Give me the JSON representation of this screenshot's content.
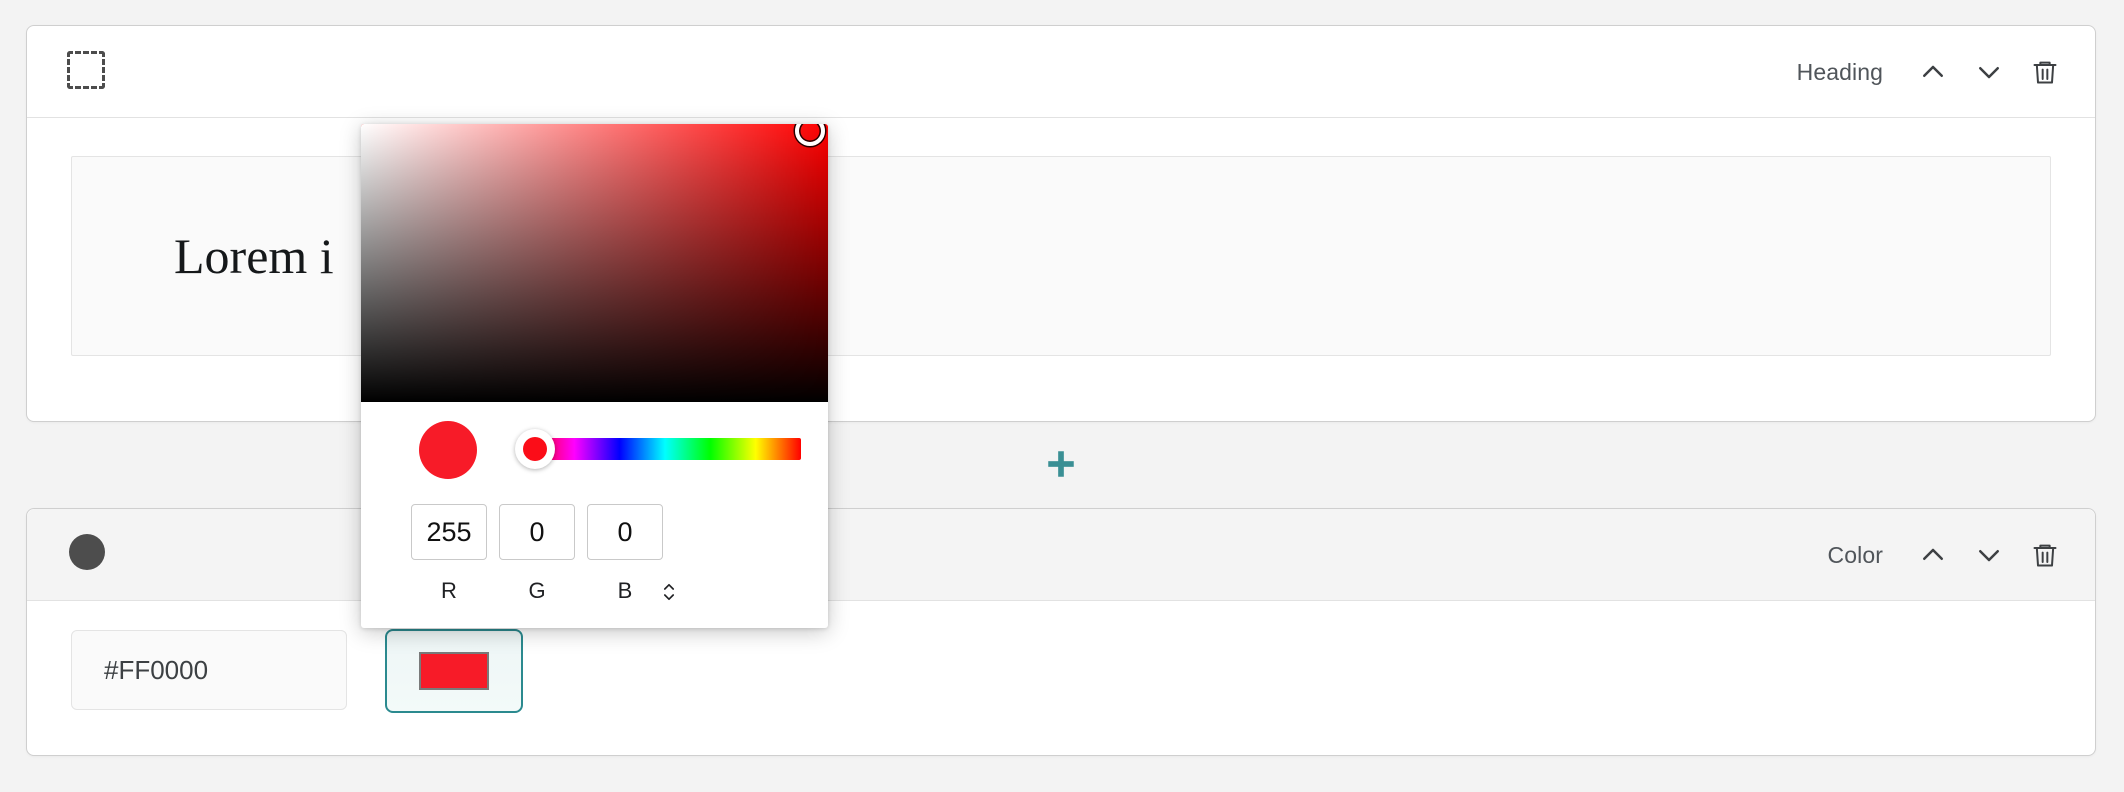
{
  "theme": {
    "page_background": "#f3f3f3",
    "accent_teal": "#2b8a8f",
    "selected_color_hex": "#FF0000",
    "selected_color_rgb_css": "#f71b28",
    "icon_gray": "#4d4d4d",
    "label_gray": "#50555a"
  },
  "blocks": [
    {
      "id": "heading",
      "icon": "dashed-square-icon",
      "type_label": "Heading",
      "move_up_label": "Move block up",
      "move_down_label": "Move block down",
      "delete_label": "Delete block",
      "field_value": "Lorem i"
    },
    {
      "id": "color",
      "icon": "filled-circle-icon",
      "type_label": "Color",
      "move_up_label": "Move block up",
      "move_down_label": "Move block down",
      "delete_label": "Delete block",
      "hex_value": "#FF0000",
      "hex_placeholder": "#FF0000",
      "swatch_label": "Open color picker"
    }
  ],
  "add_block": {
    "icon": "plus-icon",
    "label": "Add block"
  },
  "color_picker": {
    "visible": true,
    "sv_area_label": "Saturation and value area",
    "sv_handle_label": "Color selection handle",
    "preview_label": "Selected color preview",
    "hue_slider_label": "Hue slider",
    "hue_handle_label": "Hue slider handle",
    "channels": [
      {
        "key": "r",
        "label": "R",
        "value": "255"
      },
      {
        "key": "g",
        "label": "G",
        "value": "0"
      },
      {
        "key": "b",
        "label": "B",
        "value": "0"
      }
    ],
    "format_toggle": {
      "icon": "chevron-up-down-icon",
      "label": "Change color format"
    }
  }
}
